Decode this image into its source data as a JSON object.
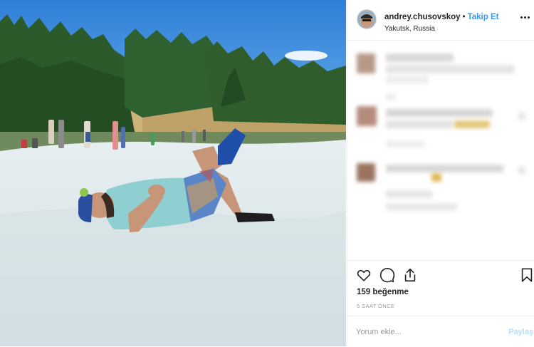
{
  "post": {
    "photo_alt": "",
    "user": {
      "username": "andrey.chusovskoy",
      "separator": "•",
      "follow_label": "Takip Et",
      "location": "Yakutsk, Russia"
    },
    "likes_text": "159 beğenme",
    "time_ago": "5 SAAT ÖNCE",
    "comment_box": {
      "placeholder": "Yorum ekle...",
      "submit_label": "Paylaş"
    },
    "icons": [
      "heart-icon",
      "comment-icon",
      "share-icon",
      "bookmark-icon",
      "more-options-icon"
    ],
    "colors": {
      "follow": "#3897f0",
      "submit_disabled": "#b2dffc",
      "border": "#efefef"
    }
  }
}
